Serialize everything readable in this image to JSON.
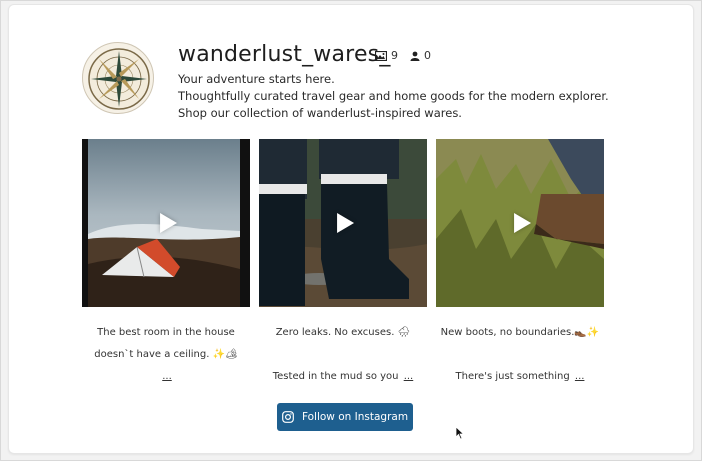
{
  "profile": {
    "username": "wanderlust_wares_",
    "posts_count": "9",
    "followers_count": "0",
    "bio": [
      "Your adventure starts here.",
      "Thoughtfully curated travel gear and home goods for the modern explorer.",
      "Shop our collection of wanderlust-inspired wares."
    ]
  },
  "posts": [
    {
      "caption_line1": "The best room in the house",
      "caption_line2": "doesn`t have a ceiling. ✨🏕",
      "more": "..."
    },
    {
      "caption_line1": "Zero leaks. No excuses. 🌧",
      "caption_line2": "Tested in the mud so you",
      "more": "..."
    },
    {
      "caption_line1": "New boots, no boundaries.👞✨",
      "caption_line2": "There's just something",
      "more": "..."
    }
  ],
  "follow_button": {
    "label": "Follow on Instagram"
  },
  "icons": {
    "posts": "image-icon",
    "followers": "user-icon",
    "instagram": "instagram-icon",
    "play": "play-icon",
    "cursor": "mouse-pointer-icon"
  },
  "colors": {
    "button_bg": "#1e5f8f",
    "button_text": "#ffffff"
  }
}
